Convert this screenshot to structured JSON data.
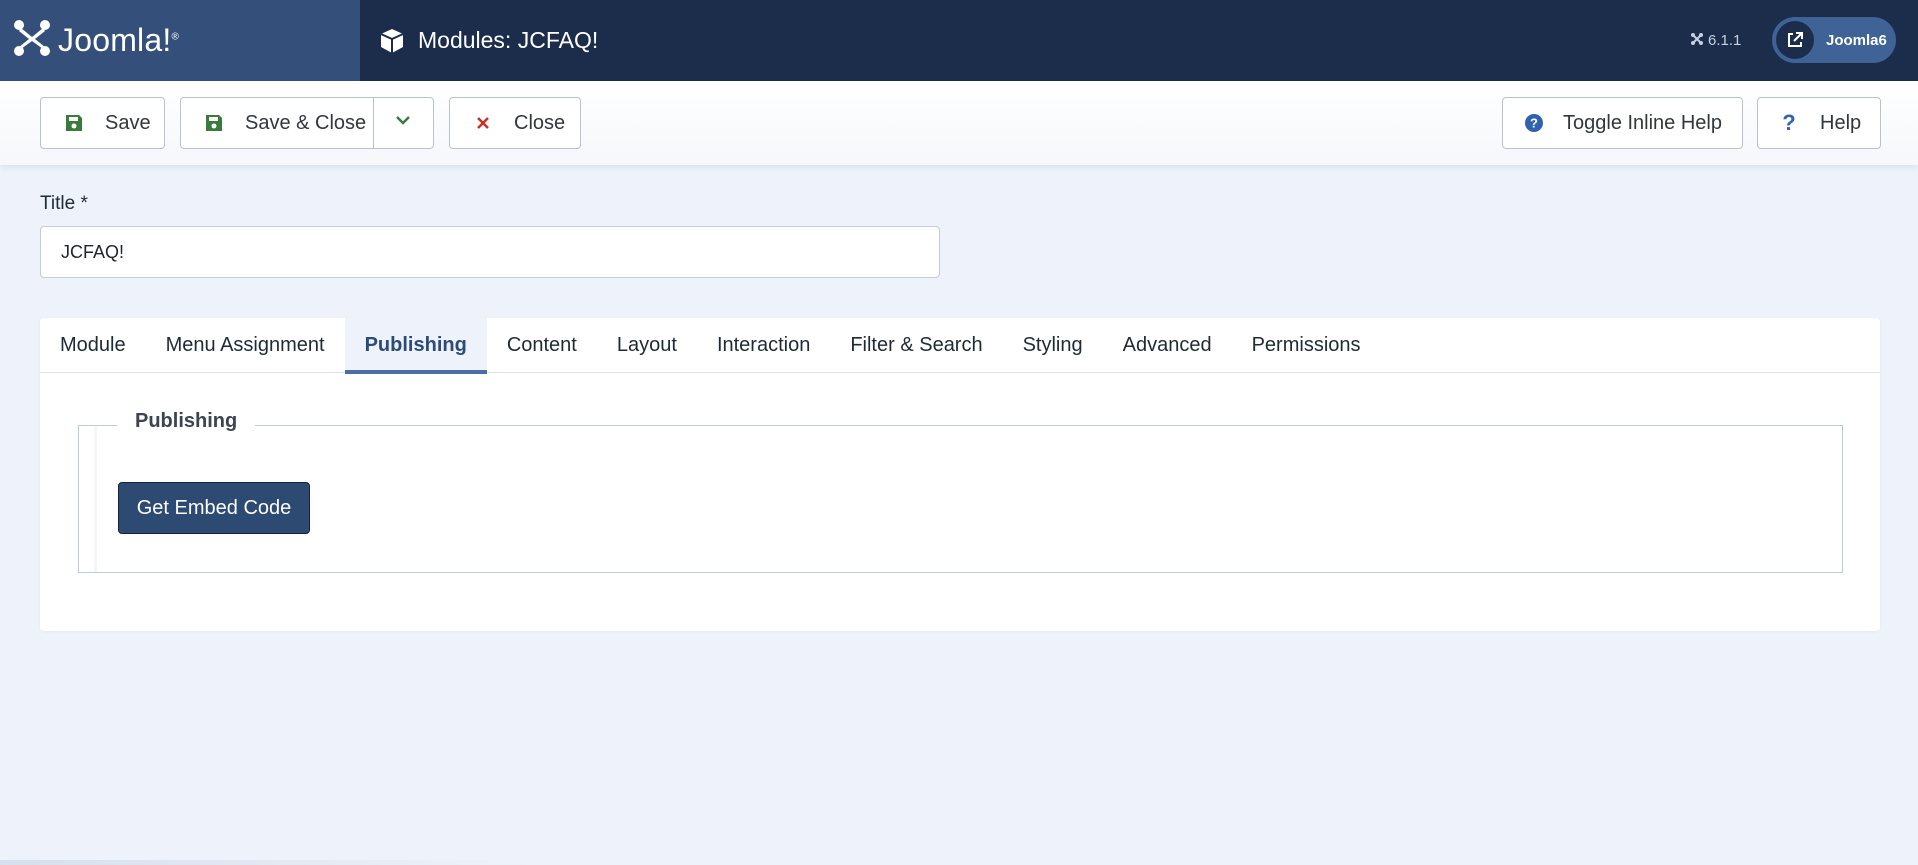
{
  "header": {
    "logo_text": "Joomla!",
    "page_title": "Modules: JCFAQ!",
    "version": "6.1.1",
    "user_label": "Joomla6"
  },
  "toolbar": {
    "save_label": "Save",
    "save_close_label": "Save & Close",
    "close_label": "Close",
    "toggle_help_label": "Toggle Inline Help",
    "help_label": "Help"
  },
  "form": {
    "title_label": "Title *",
    "title_value": "JCFAQ!"
  },
  "tabs": [
    {
      "label": "Module"
    },
    {
      "label": "Menu Assignment"
    },
    {
      "label": "Publishing",
      "active": true
    },
    {
      "label": "Content"
    },
    {
      "label": "Layout"
    },
    {
      "label": "Interaction"
    },
    {
      "label": "Filter & Search"
    },
    {
      "label": "Styling"
    },
    {
      "label": "Advanced"
    },
    {
      "label": "Permissions"
    }
  ],
  "publishing": {
    "legend": "Publishing",
    "embed_button_label": "Get Embed Code"
  },
  "colors": {
    "header_bg": "#1c2d4b",
    "logo_bg": "#334f7a",
    "page_bg": "#eef3fb",
    "accent": "#2d4a73",
    "save_icon": "#3a7a3a",
    "close_icon": "#c9302c",
    "help_icon": "#2f62b0"
  },
  "icons": {
    "logo": "joomla-logo-icon",
    "module": "cube-icon",
    "version": "joomla-small-icon",
    "user": "external-link-icon",
    "save": "floppy-disk-icon",
    "dropdown": "chevron-down-icon",
    "close": "close-x-icon",
    "toggle_help": "question-circle-icon",
    "help": "question-icon"
  }
}
